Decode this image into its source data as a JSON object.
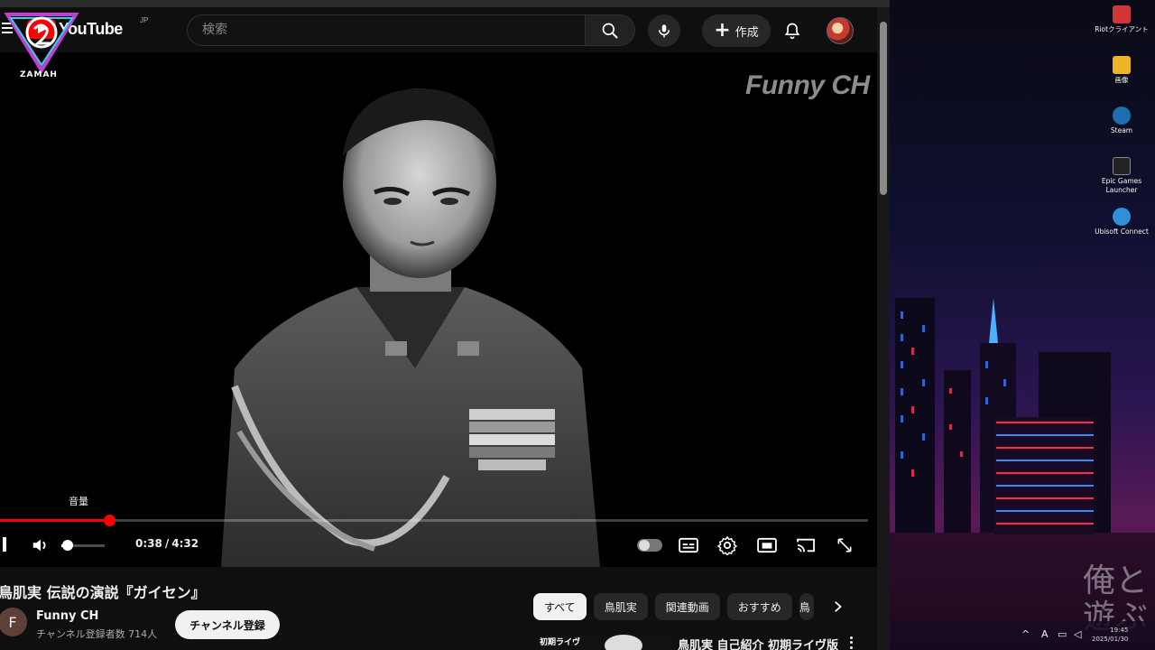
{
  "masthead": {
    "logo_text": "YouTube",
    "region": "JP",
    "search_placeholder": "検索",
    "create_label": "作成"
  },
  "overlay": {
    "badge_text": "ZAMAH"
  },
  "player": {
    "watermark": "Funny CH",
    "volume_tooltip": "音量",
    "current_time": "0:38",
    "time_separator": "/",
    "duration": "4:32",
    "progress_fraction": 0.126,
    "volume_fraction": 0.15
  },
  "video": {
    "title": "鳥肌実 伝説の演説『ガイセン』",
    "channel_initial": "F",
    "channel_name": "Funny CH",
    "subscribers": "チャンネル登録者数 714人",
    "subscribe_label": "チャンネル登録"
  },
  "chips": [
    "すべて",
    "鳥肌実",
    "関連動画",
    "おすすめ",
    "鳥"
  ],
  "recommendation": {
    "thumb_text": "初期ライヴ",
    "title": "鳥肌実 自己紹介 初期ライヴ版"
  },
  "desktop": {
    "icons": [
      {
        "name": "riot",
        "label": "Riotクライアント",
        "color": "#d13639"
      },
      {
        "name": "folder",
        "label": "画像",
        "color": "#f0b429"
      },
      {
        "name": "steam",
        "label": "Steam",
        "color": "#1b6fb0"
      },
      {
        "name": "epic",
        "label": "Epic Games Launcher",
        "color": "#222222"
      },
      {
        "name": "ubisoft",
        "label": "Ubisoft Connect",
        "color": "#2f8fd8"
      }
    ],
    "calligraphy_line1": "俺と",
    "calligraphy_line2": "遊ぶ",
    "tray_ime": "A",
    "clock_time": "19:45",
    "clock_date": "2025/01/30"
  },
  "colors": {
    "accent": "#ff0000",
    "background": "#0f0f0f",
    "chip_bg": "#272727"
  }
}
